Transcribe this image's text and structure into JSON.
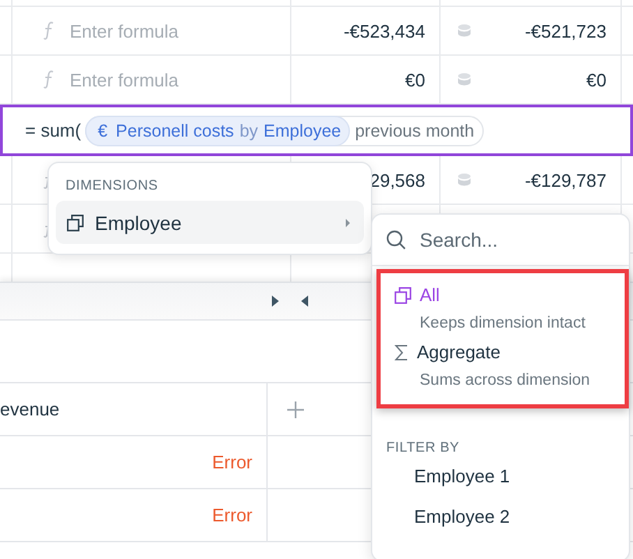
{
  "grid": {
    "rows": [
      {
        "kind": "cell",
        "placeholder": "Enter formula",
        "value": "-€523,434",
        "value_2": "-€521,723"
      },
      {
        "kind": "cell",
        "placeholder": "Enter formula",
        "value": "€0",
        "value_2": "€0"
      },
      {
        "kind": "editor",
        "prefix": "= sum(",
        "chip": {
          "icon": "€",
          "measure": "Personell costs",
          "joiner": "by",
          "dimension": "Employee"
        },
        "modifier": "previous month"
      },
      {
        "kind": "cell",
        "value": "29,568",
        "value_2": "-€129,787"
      },
      {
        "kind": "cell"
      }
    ]
  },
  "dimensions_menu": {
    "heading": "DIMENSIONS",
    "items": [
      {
        "label": "Employee",
        "selected": true
      }
    ]
  },
  "submenu": {
    "search": {
      "placeholder": "Search..."
    },
    "modes_highlighted": true,
    "modes": [
      {
        "kind": "keep",
        "label": "All",
        "description": "Keeps dimension intact",
        "selected": true
      },
      {
        "kind": "aggregate",
        "label": "Aggregate",
        "description": "Sums across dimension",
        "selected": false
      }
    ],
    "filter_heading": "FILTER BY",
    "filters": [
      {
        "label": "Employee 1"
      },
      {
        "label": "Employee 2"
      }
    ]
  },
  "lower_table": {
    "columns": [
      "evenue"
    ],
    "rows": [
      {
        "cell": "Error"
      },
      {
        "cell": "Error"
      }
    ]
  }
}
